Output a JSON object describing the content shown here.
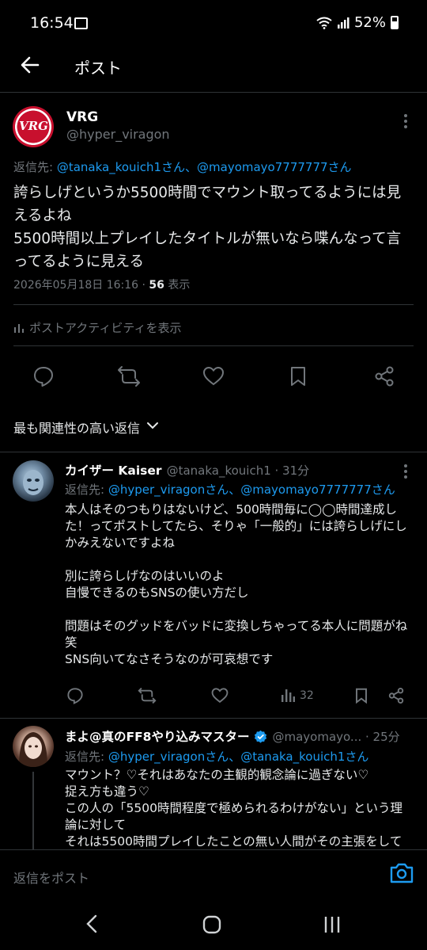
{
  "status_bar": {
    "time": "16:54",
    "battery": "52%"
  },
  "header": {
    "title": "ポスト"
  },
  "main_post": {
    "author_name": "VRG",
    "avatar_text": "VRG",
    "handle": "@hyper_viragon",
    "reply_prefix": "返信先: ",
    "reply_targets": "@tanaka_kouich1さん、@mayomayo7777777さん",
    "body": "誇らしげというか5500時間でマウント取ってるようには見\nえるよね\n5500時間以上プレイしたタイトルが無いなら喋んなって言\nってるように見える",
    "timestamp": "2026年05月18日 16:16 · ",
    "views_count": "56",
    "views_label": " 表示",
    "activity_label": "ポストアクティビティを表示"
  },
  "sort": {
    "label": "最も関連性の高い返信"
  },
  "replies": [
    {
      "name": "カイザー  Kaiser",
      "handle": "@tanaka_kouich1 · 31分",
      "reply_prefix": "返信先: ",
      "reply_targets": "@hyper_viragonさん、@mayomayo7777777さん",
      "body": "本人はそのつもりはないけど、500時間毎に◯◯時間達成し\nた！ってポストしてたら、そりゃ「一般的」には誇らしげにし\nかみえないですよね\n\n別に誇らしげなのはいいのよ\n自慢できるのもSNSの使い方だし\n\n問題はそのグッドをバッドに変換しちゃってる本人に問題がね\n笑\nSNS向いてなさそうなのが可哀想です",
      "views": "32"
    },
    {
      "name": "まよ@真のFF8やり込みマスター",
      "handle": "@mayomayo... · 25分",
      "reply_prefix": "返信先: ",
      "reply_targets": "@hyper_viragonさん、@tanaka_kouich1さん",
      "body": "マウント？♡それはあなたの主観的観念論に過ぎない♡\n捉え方も違う♡\nこの人の「5500時間程度で極められるわけがない」という理\n論に対して\nそれは5500時間プレイしたことの無い人間がその主張をして"
    }
  ],
  "compose": {
    "placeholder": "返信をポスト"
  },
  "colors": {
    "accent": "#1d9bf0",
    "background": "#000000",
    "muted": "#71767b",
    "divider": "#2f3336"
  }
}
